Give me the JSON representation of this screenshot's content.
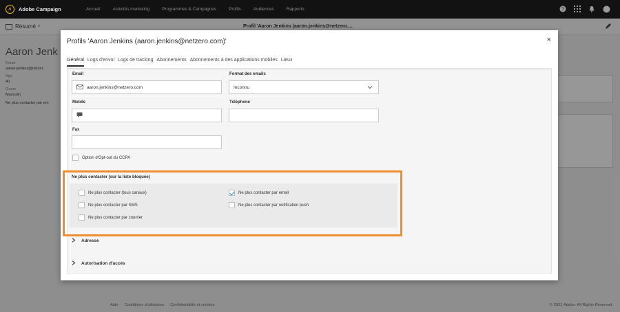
{
  "app": {
    "name": "Adobe Campaign",
    "logo_glyph": "a"
  },
  "nav": {
    "items": [
      "Accueil",
      "Activités marketing",
      "Programmes & Campagnes",
      "Profils",
      "Audiences",
      "Rapports"
    ]
  },
  "top_icons": {
    "help": "?",
    "apps": "⋮⋮",
    "bell": "🔔",
    "avatar": "●"
  },
  "background": {
    "summary_label": "Résumé",
    "profile_title": "Profil 'Aaron Jenkins (aaron.jenkins@netzero....",
    "name": "Aaron Jenk",
    "email_label": "Email",
    "email_value": "aaron.jenkins@netzer",
    "age_label": "Age",
    "age_value": "40",
    "gender_label": "Genre",
    "gender_value": "Masculin",
    "no_contact": "Ne plus contacter par em"
  },
  "footer": {
    "links": [
      "Aide",
      "Conditions d'utilisation",
      "Confidentialité et cookies"
    ],
    "copyright": "© 2021 Adobe. All Rights Reserved."
  },
  "modal": {
    "title": "Profils 'Aaron Jenkins (aaron.jenkins@netzero.com)'",
    "close": "×",
    "tabs": [
      "Général",
      "Logs d'envoi",
      "Logs de tracking",
      "Abonnements",
      "Abonnements à des applications mobiles",
      "Lieux"
    ],
    "fields": {
      "email_label": "Email",
      "email_value": "aaron.jenkins@netzero.com",
      "format_label": "Format des emails",
      "format_value": "Inconnu",
      "mobile_label": "Mobile",
      "mobile_value": "",
      "phone_label": "Téléphone",
      "phone_value": "",
      "fax_label": "Fax",
      "fax_value": ""
    },
    "ccpa_label": "Option d'Opt-out du CCPA",
    "ccpa_checked": false,
    "blocklist": {
      "title": "Ne plus contacter (sur la liste bloquée)",
      "options": [
        {
          "label": "Ne plus contacter (tous canaux)",
          "checked": false
        },
        {
          "label": "Ne plus contacter par email",
          "checked": true
        },
        {
          "label": "Ne plus contacter par SMS",
          "checked": false
        },
        {
          "label": "Ne plus contacter par notification push",
          "checked": false
        },
        {
          "label": "Ne plus contacter par courrier",
          "checked": false
        }
      ]
    },
    "sections": [
      "Adresse",
      "Autorisation d'accès"
    ]
  },
  "colors": {
    "highlight": "#f28c28",
    "topbar": "#121212",
    "checkbox_accent": "#2680eb"
  }
}
